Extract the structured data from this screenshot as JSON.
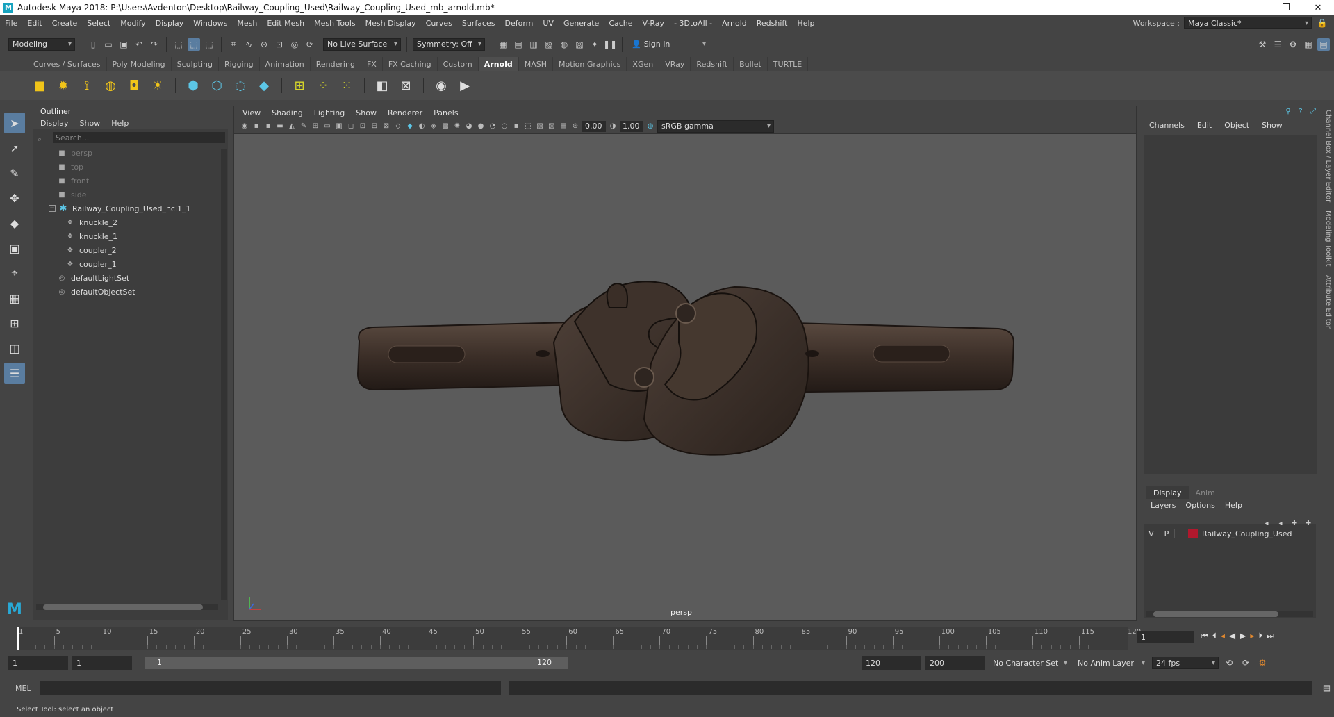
{
  "window": {
    "title": "Autodesk Maya 2018: P:\\Users\\Avdenton\\Desktop\\Railway_Coupling_Used\\Railway_Coupling_Used_mb_arnold.mb*"
  },
  "menus": [
    "File",
    "Edit",
    "Create",
    "Select",
    "Modify",
    "Display",
    "Windows",
    "Mesh",
    "Edit Mesh",
    "Mesh Tools",
    "Mesh Display",
    "Curves",
    "Surfaces",
    "Deform",
    "UV",
    "Generate",
    "Cache",
    "V-Ray",
    "- 3DtoAll -",
    "Arnold",
    "Redshift",
    "Help"
  ],
  "workspace": {
    "label": "Workspace :",
    "value": "Maya Classic*"
  },
  "statusline": {
    "mode": "Modeling",
    "live_surface": "No Live Surface",
    "symmetry": "Symmetry: Off",
    "sign_in": "Sign In"
  },
  "shelf_tabs": [
    "Curves / Surfaces",
    "Poly Modeling",
    "Sculpting",
    "Rigging",
    "Animation",
    "Rendering",
    "FX",
    "FX Caching",
    "Custom",
    "Arnold",
    "MASH",
    "Motion Graphics",
    "XGen",
    "VRay",
    "Redshift",
    "Bullet",
    "TURTLE"
  ],
  "shelf_active": "Arnold",
  "outliner": {
    "title": "Outliner",
    "menu": [
      "Display",
      "Show",
      "Help"
    ],
    "search_placeholder": "Search...",
    "items": [
      {
        "label": "persp",
        "icon": "camera-icon",
        "dim": true
      },
      {
        "label": "top",
        "icon": "camera-icon",
        "dim": true
      },
      {
        "label": "front",
        "icon": "camera-icon",
        "dim": true
      },
      {
        "label": "side",
        "icon": "camera-icon",
        "dim": true
      },
      {
        "label": "Railway_Coupling_Used_ncl1_1",
        "icon": "group-icon",
        "dim": false
      },
      {
        "label": "knuckle_2",
        "icon": "mesh-icon",
        "dim": false
      },
      {
        "label": "knuckle_1",
        "icon": "mesh-icon",
        "dim": false
      },
      {
        "label": "coupler_2",
        "icon": "mesh-icon",
        "dim": false
      },
      {
        "label": "coupler_1",
        "icon": "mesh-icon",
        "dim": false
      },
      {
        "label": "defaultLightSet",
        "icon": "set-icon",
        "dim": false
      },
      {
        "label": "defaultObjectSet",
        "icon": "set-icon",
        "dim": false
      }
    ]
  },
  "viewport": {
    "menu": [
      "View",
      "Shading",
      "Lighting",
      "Show",
      "Renderer",
      "Panels"
    ],
    "exposure": "0.00",
    "gamma": "1.00",
    "color_space": "sRGB gamma",
    "camera_label": "persp"
  },
  "channelbox": {
    "menu": [
      "Channels",
      "Edit",
      "Object",
      "Show"
    ],
    "layer_tabs": [
      "Display",
      "Anim"
    ],
    "layer_menu": [
      "Layers",
      "Options",
      "Help"
    ],
    "layer": {
      "v": "V",
      "p": "P",
      "name": "Railway_Coupling_Used",
      "color": "#b0182d"
    }
  },
  "side_tabs": [
    "Channel Box / Layer Editor",
    "Modeling Toolkit",
    "Attribute Editor"
  ],
  "timeline": {
    "ticks": [
      "1",
      "5",
      "10",
      "15",
      "20",
      "25",
      "30",
      "35",
      "40",
      "45",
      "50",
      "55",
      "60",
      "65",
      "70",
      "75",
      "80",
      "85",
      "90",
      "95",
      "100",
      "105",
      "110",
      "115",
      "120"
    ],
    "current_frame": "1"
  },
  "range": {
    "start": "1",
    "playback_start": "1",
    "slider_start": "1",
    "slider_end": "120",
    "playback_end": "120",
    "end": "200",
    "character_set": "No Character Set",
    "anim_layer": "No Anim Layer",
    "fps": "24 fps"
  },
  "cmdline": {
    "label": "MEL"
  },
  "helpline": {
    "text": "Select Tool: select an object"
  }
}
